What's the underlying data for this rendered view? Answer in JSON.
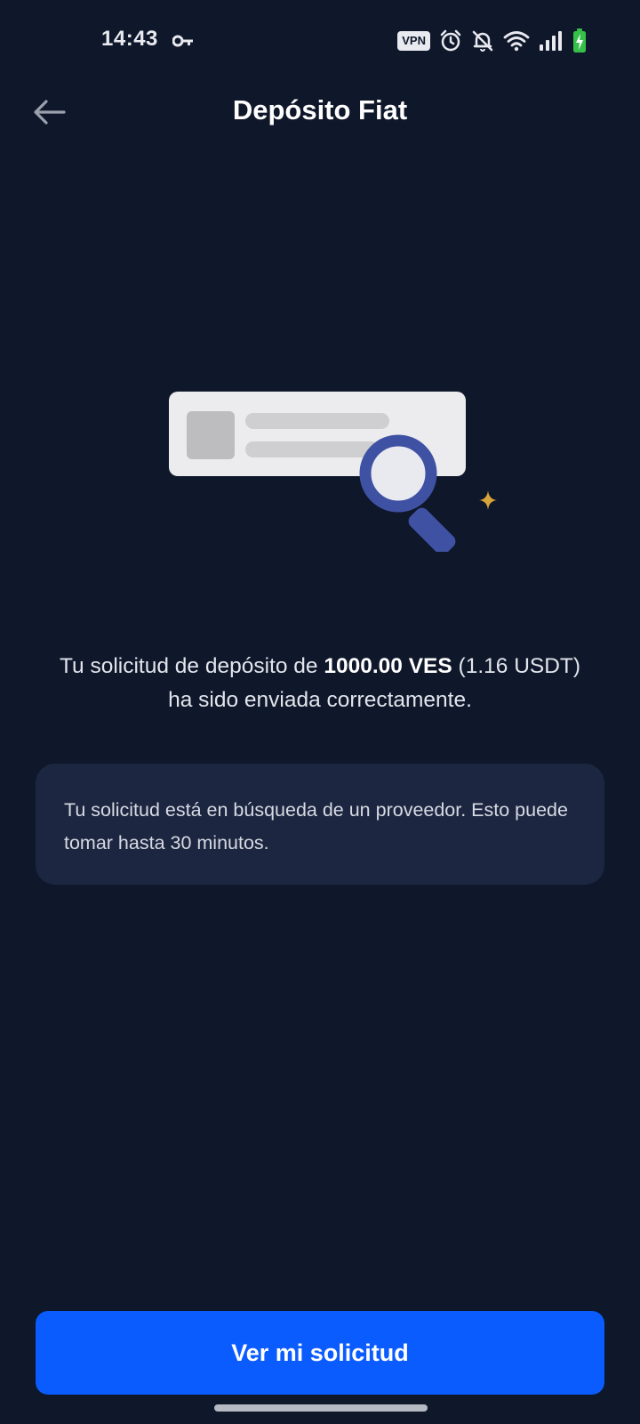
{
  "status_bar": {
    "time": "14:43",
    "vpn_label": "VPN",
    "icons": [
      "key-icon",
      "vpn-icon",
      "alarm-icon",
      "bell-off-icon",
      "wifi-icon",
      "signal-icon",
      "battery-charging-icon"
    ]
  },
  "header": {
    "title": "Depósito Fiat",
    "back_icon": "arrow-left-icon"
  },
  "illustration": {
    "icon": "search-document-icon",
    "colors": {
      "card": "#ececef",
      "placeholder": "#bdbdc0",
      "magnifier": "#3f51a3",
      "sparkle": "#d9a53a"
    }
  },
  "message": {
    "prefix": "Tu solicitud de depósito de ",
    "amount": "1000.00 VES",
    "suffix": " (1.16 USDT) ha sido enviada correctamente."
  },
  "info_card": {
    "text": "Tu solicitud está en búsqueda de un proveedor. Esto puede tomar hasta 30 minutos."
  },
  "primary_button": {
    "label": "Ver mi solicitud"
  },
  "colors": {
    "background": "#0f172a",
    "card_background": "#1c2640",
    "primary": "#0b5cff"
  }
}
